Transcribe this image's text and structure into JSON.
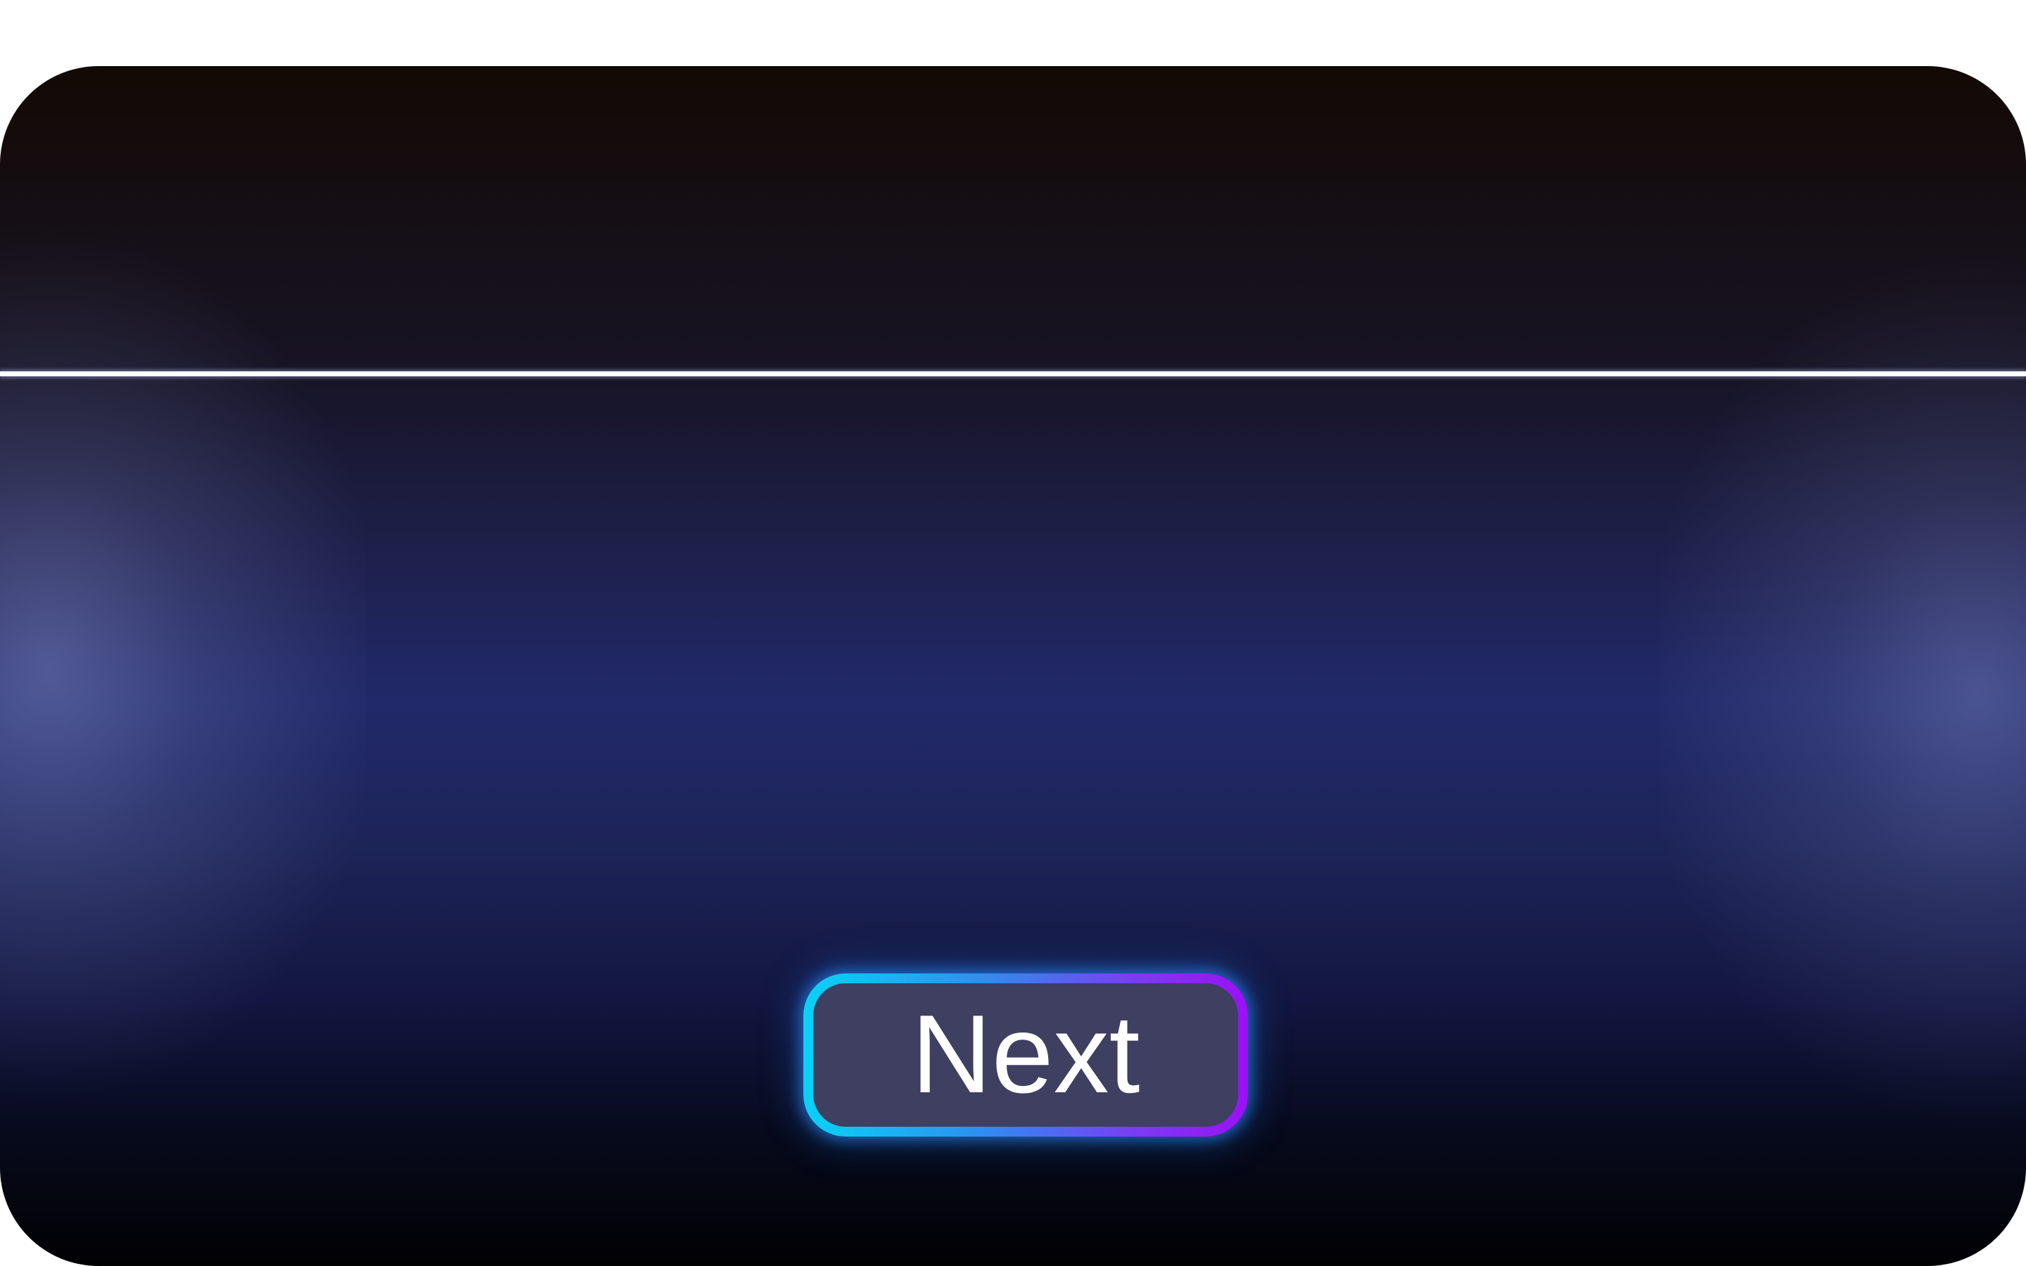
{
  "screen": {
    "colors": {
      "top": "#130904",
      "middle": "#21296a",
      "bottom": "#010103",
      "divider": "#ffffff"
    }
  },
  "next_button": {
    "label": "Next",
    "colors": {
      "fill": "#3e3f61",
      "border_start": "#0ad2f5",
      "border_end": "#9b10f5",
      "glow": "#2d8ff2",
      "text": "#ffffff"
    }
  }
}
